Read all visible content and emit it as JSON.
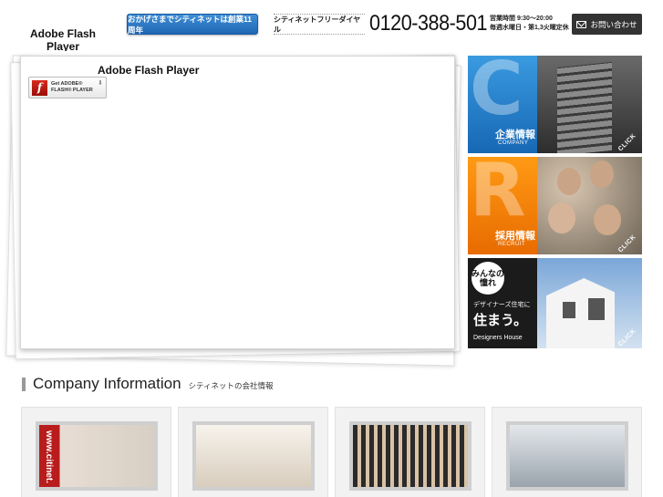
{
  "header": {
    "logo_fallback": "Adobe Flash Player",
    "anniversary_button": "おかげさまでシティネットは創業11周年",
    "freedial_label": "シティネットフリーダイヤル",
    "phone_number": "0120-388-501",
    "hours_line1": "営業時間 9:30〜20:00",
    "hours_line2": "毎週水曜日・第1,3火曜定休",
    "contact_label": "お問い合わせ"
  },
  "flash": {
    "title": "Adobe Flash Player",
    "get_line1": "Get ADOBE®",
    "get_line2": "FLASH® PLAYER"
  },
  "banners": {
    "company": {
      "letter": "C",
      "jp": "企業情報",
      "en": "COMPANY",
      "click": "CLICK"
    },
    "recruit": {
      "letter": "R",
      "jp": "採用情報",
      "en": "RECRUIT",
      "click": "CLICK"
    },
    "house": {
      "badge": "みんなの憧れ",
      "jp_line": "デザイナーズ住宅に",
      "sumau": "住まう。",
      "en": "Designers House",
      "click": "CLICK"
    }
  },
  "company_section": {
    "title_en": "Company Information",
    "title_jp": "シティネットの会社情報",
    "card1_text": "www.citinet."
  },
  "colors": {
    "company_accent": "#2a86d4",
    "recruit_accent": "#f58a0a",
    "contact_bg": "#333333"
  }
}
